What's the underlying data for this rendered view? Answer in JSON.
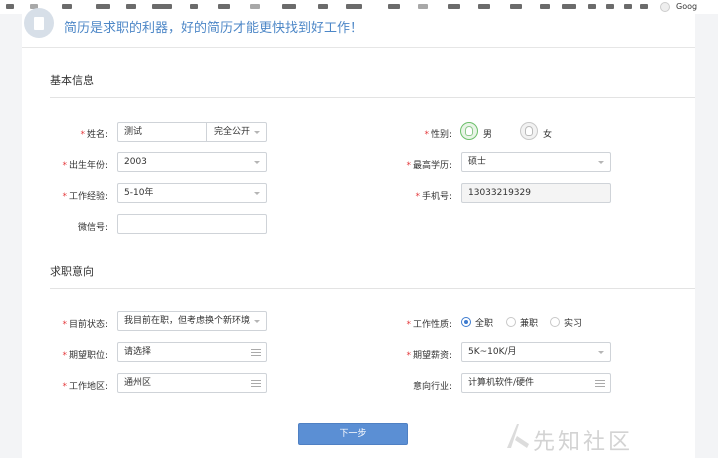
{
  "browser": {
    "bookmark_tail": "Goog"
  },
  "banner": {
    "text": "简历是求职的利器，好的简历才能更快找到好工作！"
  },
  "sections": {
    "basic_title": "基本信息",
    "intent_title": "求职意向"
  },
  "basic": {
    "name": {
      "label": "姓名:",
      "value": "测试",
      "visibility": "完全公开"
    },
    "gender": {
      "label": "性别:",
      "options": [
        "男",
        "女"
      ],
      "selected": "男"
    },
    "birth_year": {
      "label": "出生年份:",
      "value": "2003"
    },
    "education": {
      "label": "最高学历:",
      "value": "硕士"
    },
    "experience": {
      "label": "工作经验:",
      "value": "5-10年"
    },
    "phone": {
      "label": "手机号:",
      "value": "13033219329"
    },
    "wechat": {
      "label": "微信号:",
      "value": ""
    }
  },
  "intent": {
    "status": {
      "label": "目前状态:",
      "value": "我目前在职，但考虑换个新环境"
    },
    "job_type": {
      "label": "工作性质:",
      "options": [
        "全职",
        "兼职",
        "实习"
      ],
      "selected": "全职"
    },
    "position": {
      "label": "期望职位:",
      "value": "请选择"
    },
    "salary": {
      "label": "期望薪资:",
      "value": "5K~10K/月"
    },
    "location": {
      "label": "工作地区:",
      "value": "通州区"
    },
    "industry": {
      "label": "意向行业:",
      "value": "计算机软件/硬件"
    }
  },
  "actions": {
    "next_label": "下一步"
  },
  "watermark": {
    "text": "先知社区"
  },
  "colors": {
    "accent": "#5b8fd4",
    "required": "#e4393c",
    "banner_text": "#4d87c7"
  }
}
